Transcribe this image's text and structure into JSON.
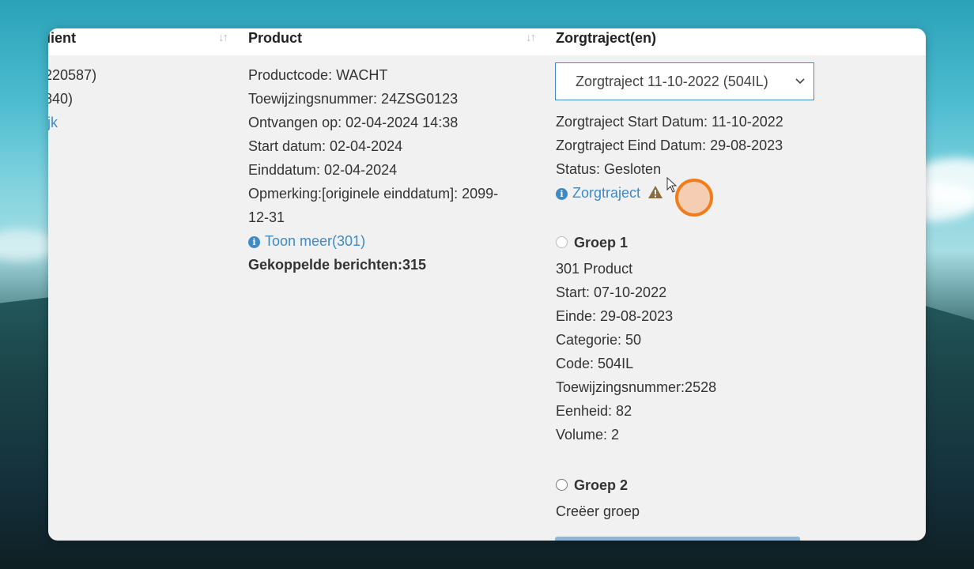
{
  "table": {
    "headers": {
      "client": "lient",
      "product": "Product",
      "zorgtraject": "Zorgtraject(en)"
    },
    "client_lines": [
      "220587)",
      "840)"
    ],
    "client_link": "ijk",
    "product": {
      "lines": [
        "Productcode: WACHT",
        "Toewijzingsnummer: 24ZSG0123",
        "Ontvangen op: 02-04-2024 14:38",
        "Start datum: 02-04-2024",
        "Einddatum: 02-04-2024",
        "Opmerking:[originele einddatum]: 2099-",
        "12-31"
      ],
      "toon_meer": "Toon meer(301)",
      "gekoppelde": "Gekoppelde berichten:315"
    },
    "zorgtraject": {
      "select_value": "Zorgtraject 11-10-2022 (504IL)",
      "lines": [
        "Zorgtraject Start Datum: 11-10-2022",
        "Zorgtraject Eind Datum: 29-08-2023",
        "Status: Gesloten"
      ],
      "link": "Zorgtraject",
      "groep1": {
        "label": "Groep 1",
        "lines": [
          "301 Product",
          "Start: 07-10-2022",
          "Einde: 29-08-2023",
          "Categorie: 50",
          "Code: 504IL",
          "Toewijzingsnummer:2528",
          "Eenheid: 82",
          "Volume: 2"
        ]
      },
      "groep2": {
        "label": "Groep 2",
        "create": "Creëer groep"
      }
    }
  },
  "colors": {
    "accent": "#3d8ac4",
    "highlight_ring": "#f07d1a",
    "warning": "#8a6d3b"
  }
}
